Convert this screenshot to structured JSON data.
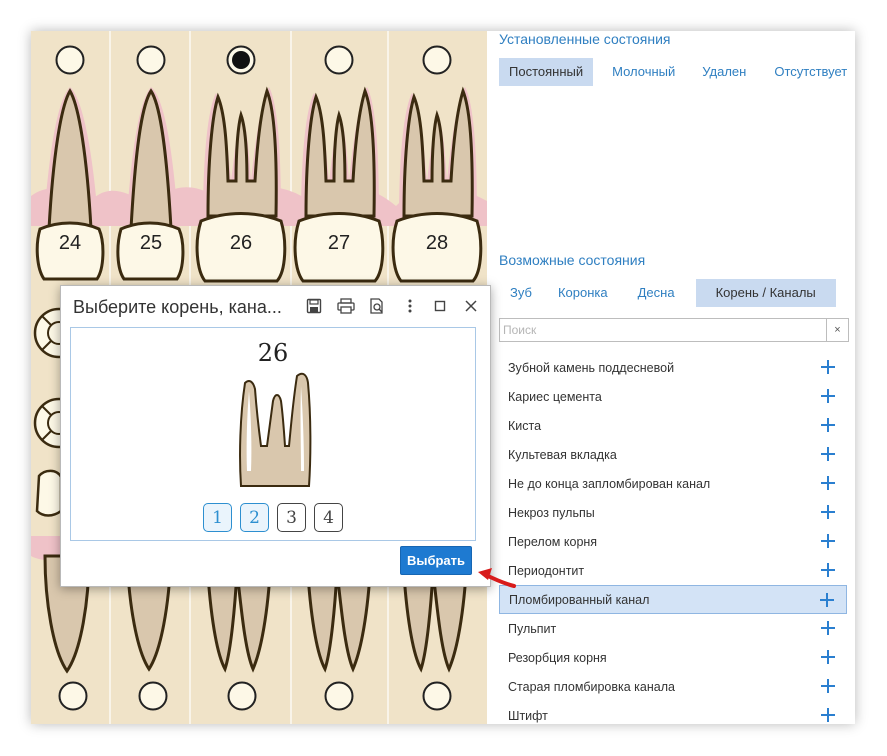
{
  "chart": {
    "upper_teeth": [
      "24",
      "25",
      "26",
      "27",
      "28"
    ]
  },
  "installed": {
    "title": "Установленные состояния",
    "tabs": [
      "Постоянный",
      "Молочный",
      "Удален",
      "Отсутствует"
    ]
  },
  "possible": {
    "title": "Возможные состояния",
    "tabs": [
      "Зуб",
      "Коронка",
      "Десна",
      "Корень / Каналы"
    ],
    "search_placeholder": "Поиск",
    "clear_icon": "×",
    "items": [
      "Зубной камень поддесневой",
      "Кариес цемента",
      "Киста",
      "Культевая вкладка",
      "Не до конца запломбирован канал",
      "Некроз пульпы",
      "Перелом корня",
      "Периодонтит",
      "Пломбированный канал",
      "Пульпит",
      "Резорбция корня",
      "Старая пломбировка канала",
      "Штифт"
    ],
    "selected_item": "Пломбированный канал"
  },
  "dialog": {
    "title": "Выберите корень, кана...",
    "tooth_number": "26",
    "canals": [
      "1",
      "2",
      "3",
      "4"
    ],
    "selected_canals": [
      "1",
      "2"
    ],
    "choose_label": "Выбрать"
  },
  "colors": {
    "accent": "#1e7ad1",
    "link": "#2f7fc1",
    "arrow": "#d81b1b"
  }
}
